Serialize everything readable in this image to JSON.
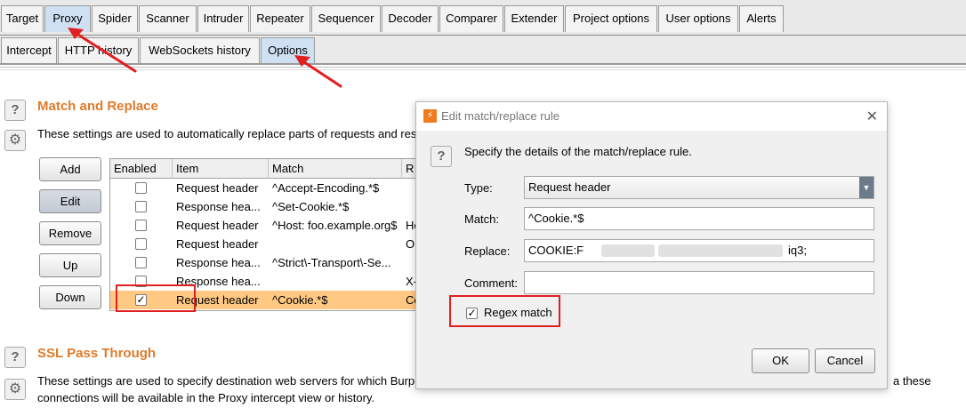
{
  "main_tabs": [
    "Target",
    "Proxy",
    "Spider",
    "Scanner",
    "Intruder",
    "Repeater",
    "Sequencer",
    "Decoder",
    "Comparer",
    "Extender",
    "Project options",
    "User options",
    "Alerts"
  ],
  "proxy_tabs": [
    "Intercept",
    "HTTP history",
    "WebSockets history",
    "Options"
  ],
  "match_replace": {
    "title": "Match and Replace",
    "description": "These settings are used to automatically replace parts of requests and res",
    "buttons": {
      "add": "Add",
      "edit": "Edit",
      "remove": "Remove",
      "up": "Up",
      "down": "Down"
    },
    "columns": [
      "Enabled",
      "Item",
      "Match",
      "R"
    ],
    "rows": [
      {
        "enabled": false,
        "item": "Request header",
        "match": "^Accept-Encoding.*$",
        "replace": ""
      },
      {
        "enabled": false,
        "item": "Response hea...",
        "match": "^Set-Cookie.*$",
        "replace": ""
      },
      {
        "enabled": false,
        "item": "Request header",
        "match": "^Host: foo.example.org$",
        "replace": "Ho"
      },
      {
        "enabled": false,
        "item": "Request header",
        "match": "",
        "replace": "Or"
      },
      {
        "enabled": false,
        "item": "Response hea...",
        "match": "^Strict\\-Transport\\-Se...",
        "replace": ""
      },
      {
        "enabled": false,
        "item": "Response hea...",
        "match": "",
        "replace": "X-"
      },
      {
        "enabled": true,
        "item": "Request header",
        "match": "^Cookie.*$",
        "replace": "Co"
      }
    ],
    "check_mark": "✓"
  },
  "ssl": {
    "title": "SSL Pass Through",
    "desc_line1_left": "These settings are used to specify destination web servers for which Burp",
    "desc_line1_right": "a these",
    "desc_line2": "connections will be available in the Proxy intercept view or history."
  },
  "side_icons": {
    "help": "?",
    "gear": "⚙"
  },
  "dialog": {
    "title": "Edit match/replace rule",
    "logo": "⚡",
    "close": "✕",
    "instruction": "Specify the details of the match/replace rule.",
    "type_label": "Type:",
    "type_value": "Request header",
    "type_arrow": "▼",
    "match_label": "Match:",
    "match_value": "^Cookie.*$",
    "replace_label": "Replace:",
    "replace_prefix": "COOKIE:F",
    "replace_suffix": "iq3;",
    "comment_label": "Comment:",
    "comment_value": "",
    "regex_label": "Regex match",
    "regex_checked": true,
    "ok": "OK",
    "cancel": "Cancel"
  },
  "colors": {
    "accent_orange": "#e07b2a",
    "annotation_red": "#e02020",
    "selected_row": "#ffc984",
    "active_tab": "#cfe0f2"
  }
}
